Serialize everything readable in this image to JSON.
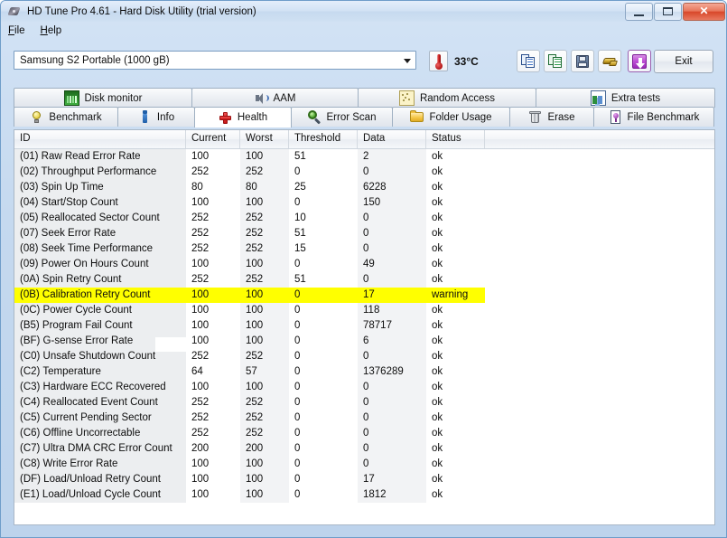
{
  "window": {
    "title": "HD Tune Pro 4.61 - Hard Disk Utility (trial version)",
    "icon": "disk-icon",
    "minimize_label": "",
    "maximize_label": "",
    "close_label": "✕"
  },
  "menu": {
    "items": [
      {
        "label": "File",
        "mnemonic": "F"
      },
      {
        "label": "Help",
        "mnemonic": "H"
      }
    ]
  },
  "toolbar": {
    "drive": {
      "selected": "Samsung S2 Portable (1000 gB)",
      "options": [
        "Samsung S2 Portable (1000 gB)"
      ]
    },
    "temperature": "33°C",
    "temperature_icon": "thermometer-icon",
    "buttons": [
      {
        "name": "copy-icon",
        "label": ""
      },
      {
        "name": "copy-to-spreadsheet-icon",
        "label": ""
      },
      {
        "name": "save-icon",
        "label": ""
      },
      {
        "name": "brush-icon",
        "label": ""
      },
      {
        "name": "download-icon",
        "label": ""
      }
    ],
    "exit_label": "Exit"
  },
  "tabs": {
    "row1": [
      {
        "label": "Disk monitor",
        "icon": "chart-monitor-icon",
        "active": false
      },
      {
        "label": "AAM",
        "icon": "speaker-icon",
        "active": false
      },
      {
        "label": "Random Access",
        "icon": "random-access-icon",
        "active": false
      },
      {
        "label": "Extra tests",
        "icon": "extra-tests-icon",
        "active": false
      }
    ],
    "row2": [
      {
        "label": "Benchmark",
        "icon": "lightbulb-icon",
        "active": false
      },
      {
        "label": "Info",
        "icon": "info-icon",
        "active": false
      },
      {
        "label": "Health",
        "icon": "red-cross-icon",
        "active": true
      },
      {
        "label": "Error Scan",
        "icon": "magnifier-icon",
        "active": false
      },
      {
        "label": "Folder Usage",
        "icon": "folder-icon",
        "active": false
      },
      {
        "label": "Erase",
        "icon": "trash-icon",
        "active": false
      },
      {
        "label": "File Benchmark",
        "icon": "file-benchmark-icon",
        "active": false
      }
    ]
  },
  "health_table": {
    "columns": [
      "ID",
      "Current",
      "Worst",
      "Threshold",
      "Data",
      "Status"
    ],
    "rows": [
      {
        "id": "(01) Raw Read Error Rate",
        "current": "100",
        "worst": "100",
        "threshold": "51",
        "data": "2",
        "status": "ok",
        "warning": false
      },
      {
        "id": "(02) Throughput Performance",
        "current": "252",
        "worst": "252",
        "threshold": "0",
        "data": "0",
        "status": "ok",
        "warning": false
      },
      {
        "id": "(03) Spin Up Time",
        "current": "80",
        "worst": "80",
        "threshold": "25",
        "data": "6228",
        "status": "ok",
        "warning": false
      },
      {
        "id": "(04) Start/Stop Count",
        "current": "100",
        "worst": "100",
        "threshold": "0",
        "data": "150",
        "status": "ok",
        "warning": false
      },
      {
        "id": "(05) Reallocated Sector Count",
        "current": "252",
        "worst": "252",
        "threshold": "10",
        "data": "0",
        "status": "ok",
        "warning": false
      },
      {
        "id": "(07) Seek Error Rate",
        "current": "252",
        "worst": "252",
        "threshold": "51",
        "data": "0",
        "status": "ok",
        "warning": false
      },
      {
        "id": "(08) Seek Time Performance",
        "current": "252",
        "worst": "252",
        "threshold": "15",
        "data": "0",
        "status": "ok",
        "warning": false
      },
      {
        "id": "(09) Power On Hours Count",
        "current": "100",
        "worst": "100",
        "threshold": "0",
        "data": "49",
        "status": "ok",
        "warning": false
      },
      {
        "id": "(0A) Spin Retry Count",
        "current": "252",
        "worst": "252",
        "threshold": "51",
        "data": "0",
        "status": "ok",
        "warning": false
      },
      {
        "id": "(0B) Calibration Retry Count",
        "current": "100",
        "worst": "100",
        "threshold": "0",
        "data": "17",
        "status": "warning",
        "warning": true
      },
      {
        "id": "(0C) Power Cycle Count",
        "current": "100",
        "worst": "100",
        "threshold": "0",
        "data": "118",
        "status": "ok",
        "warning": false
      },
      {
        "id": "(B5) Program Fail Count",
        "current": "100",
        "worst": "100",
        "threshold": "0",
        "data": "78717",
        "status": "ok",
        "warning": false
      },
      {
        "id": "(BF) G-sense Error Rate",
        "current": "100",
        "worst": "100",
        "threshold": "0",
        "data": "6",
        "status": "ok",
        "warning": false
      },
      {
        "id": "(C0) Unsafe Shutdown Count",
        "current": "252",
        "worst": "252",
        "threshold": "0",
        "data": "0",
        "status": "ok",
        "warning": false
      },
      {
        "id": "(C2) Temperature",
        "current": "64",
        "worst": "57",
        "threshold": "0",
        "data": "1376289",
        "status": "ok",
        "warning": false
      },
      {
        "id": "(C3) Hardware ECC Recovered",
        "current": "100",
        "worst": "100",
        "threshold": "0",
        "data": "0",
        "status": "ok",
        "warning": false
      },
      {
        "id": "(C4) Reallocated Event Count",
        "current": "252",
        "worst": "252",
        "threshold": "0",
        "data": "0",
        "status": "ok",
        "warning": false
      },
      {
        "id": "(C5) Current Pending Sector",
        "current": "252",
        "worst": "252",
        "threshold": "0",
        "data": "0",
        "status": "ok",
        "warning": false
      },
      {
        "id": "(C6) Offline Uncorrectable",
        "current": "252",
        "worst": "252",
        "threshold": "0",
        "data": "0",
        "status": "ok",
        "warning": false
      },
      {
        "id": "(C7) Ultra DMA CRC Error Count",
        "current": "200",
        "worst": "200",
        "threshold": "0",
        "data": "0",
        "status": "ok",
        "warning": false
      },
      {
        "id": "(C8) Write Error Rate",
        "current": "100",
        "worst": "100",
        "threshold": "0",
        "data": "0",
        "status": "ok",
        "warning": false
      },
      {
        "id": "(DF) Load/Unload Retry Count",
        "current": "100",
        "worst": "100",
        "threshold": "0",
        "data": "17",
        "status": "ok",
        "warning": false
      },
      {
        "id": "(E1) Load/Unload Cycle Count",
        "current": "100",
        "worst": "100",
        "threshold": "0",
        "data": "1812",
        "status": "ok",
        "warning": false
      }
    ]
  },
  "colors": {
    "warning_highlight": "#ffff00",
    "accent_button": "#bf52d6",
    "close_button": "#d8472a",
    "column_shade": "#eceef0"
  }
}
